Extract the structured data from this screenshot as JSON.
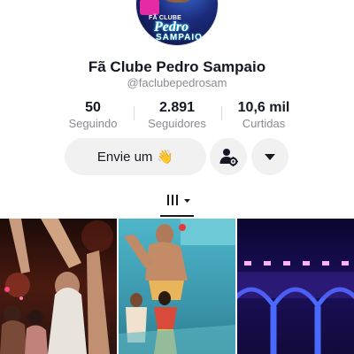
{
  "profile": {
    "avatar_text": {
      "club_label": "FÃ CLUBE",
      "first_name": "Pedro",
      "last_name": "SAMPAIO"
    },
    "display_name": "Fã Clube Pedro Sampaio",
    "handle": "@faclubepedrosam"
  },
  "stats": [
    {
      "value": "50",
      "label": "Seguindo"
    },
    {
      "value": "2.891",
      "label": "Seguidores"
    },
    {
      "value": "10,6 mil",
      "label": "Curtidas"
    }
  ],
  "actions": {
    "message_label": "Envie um",
    "message_emoji": "👋",
    "add_friend_icon": "person-gear-icon",
    "more_icon": "caret-down-icon"
  },
  "tabs": {
    "active_icon": "video-grid-icon",
    "dropdown_icon": "caret-down-icon"
  },
  "videos": [
    {
      "thumbnail": "concert-crowd-raising-arms"
    },
    {
      "thumbnail": "stage-dancers-pool-party"
    },
    {
      "thumbnail": "purple-neon-arches-stage"
    }
  ],
  "colors": {
    "text_primary": "#161823",
    "text_secondary": "#8a8b91",
    "button_bg": "#f1f1f2"
  }
}
